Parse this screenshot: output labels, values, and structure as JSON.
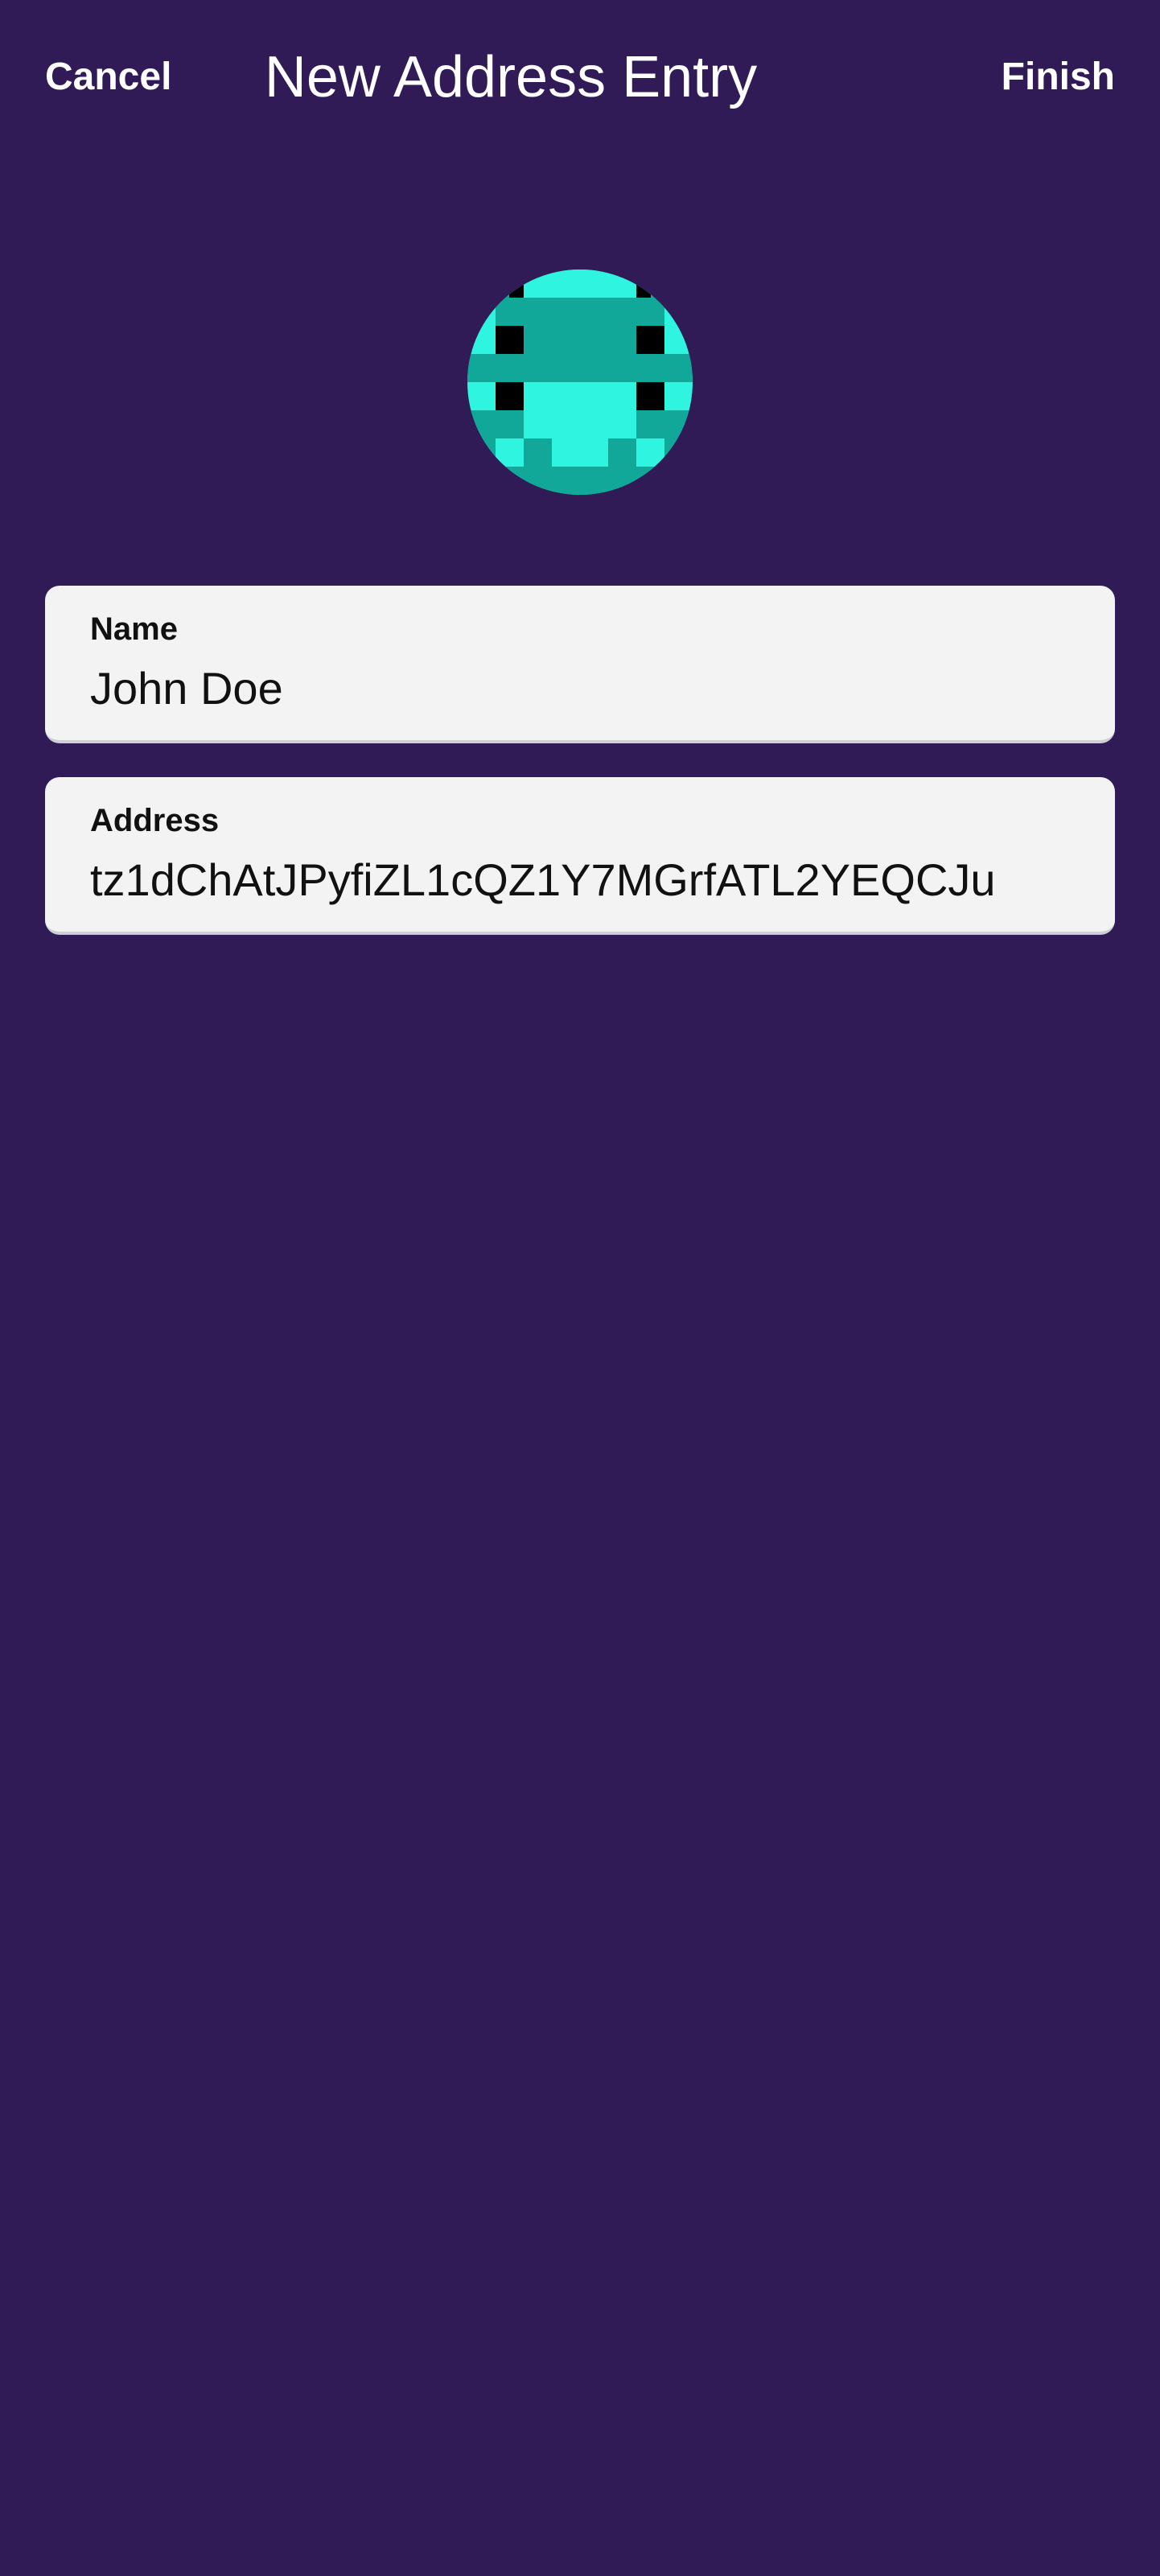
{
  "header": {
    "cancel_label": "Cancel",
    "title": "New Address Entry",
    "finish_label": "Finish"
  },
  "avatar": {
    "icon": "identicon-avatar",
    "colors": {
      "light": "#2ef4e0",
      "dark": "#11a89a",
      "black": "#000000"
    }
  },
  "form": {
    "name": {
      "label": "Name",
      "value": "John Doe"
    },
    "address": {
      "label": "Address",
      "value": "tz1dChAtJPyfiZL1cQZ1Y7MGrfATL2YEQCJu"
    }
  },
  "colors": {
    "background": "#301b57",
    "card": "#f3f3f3",
    "header_text": "#ffffff",
    "field_text": "#111111"
  }
}
